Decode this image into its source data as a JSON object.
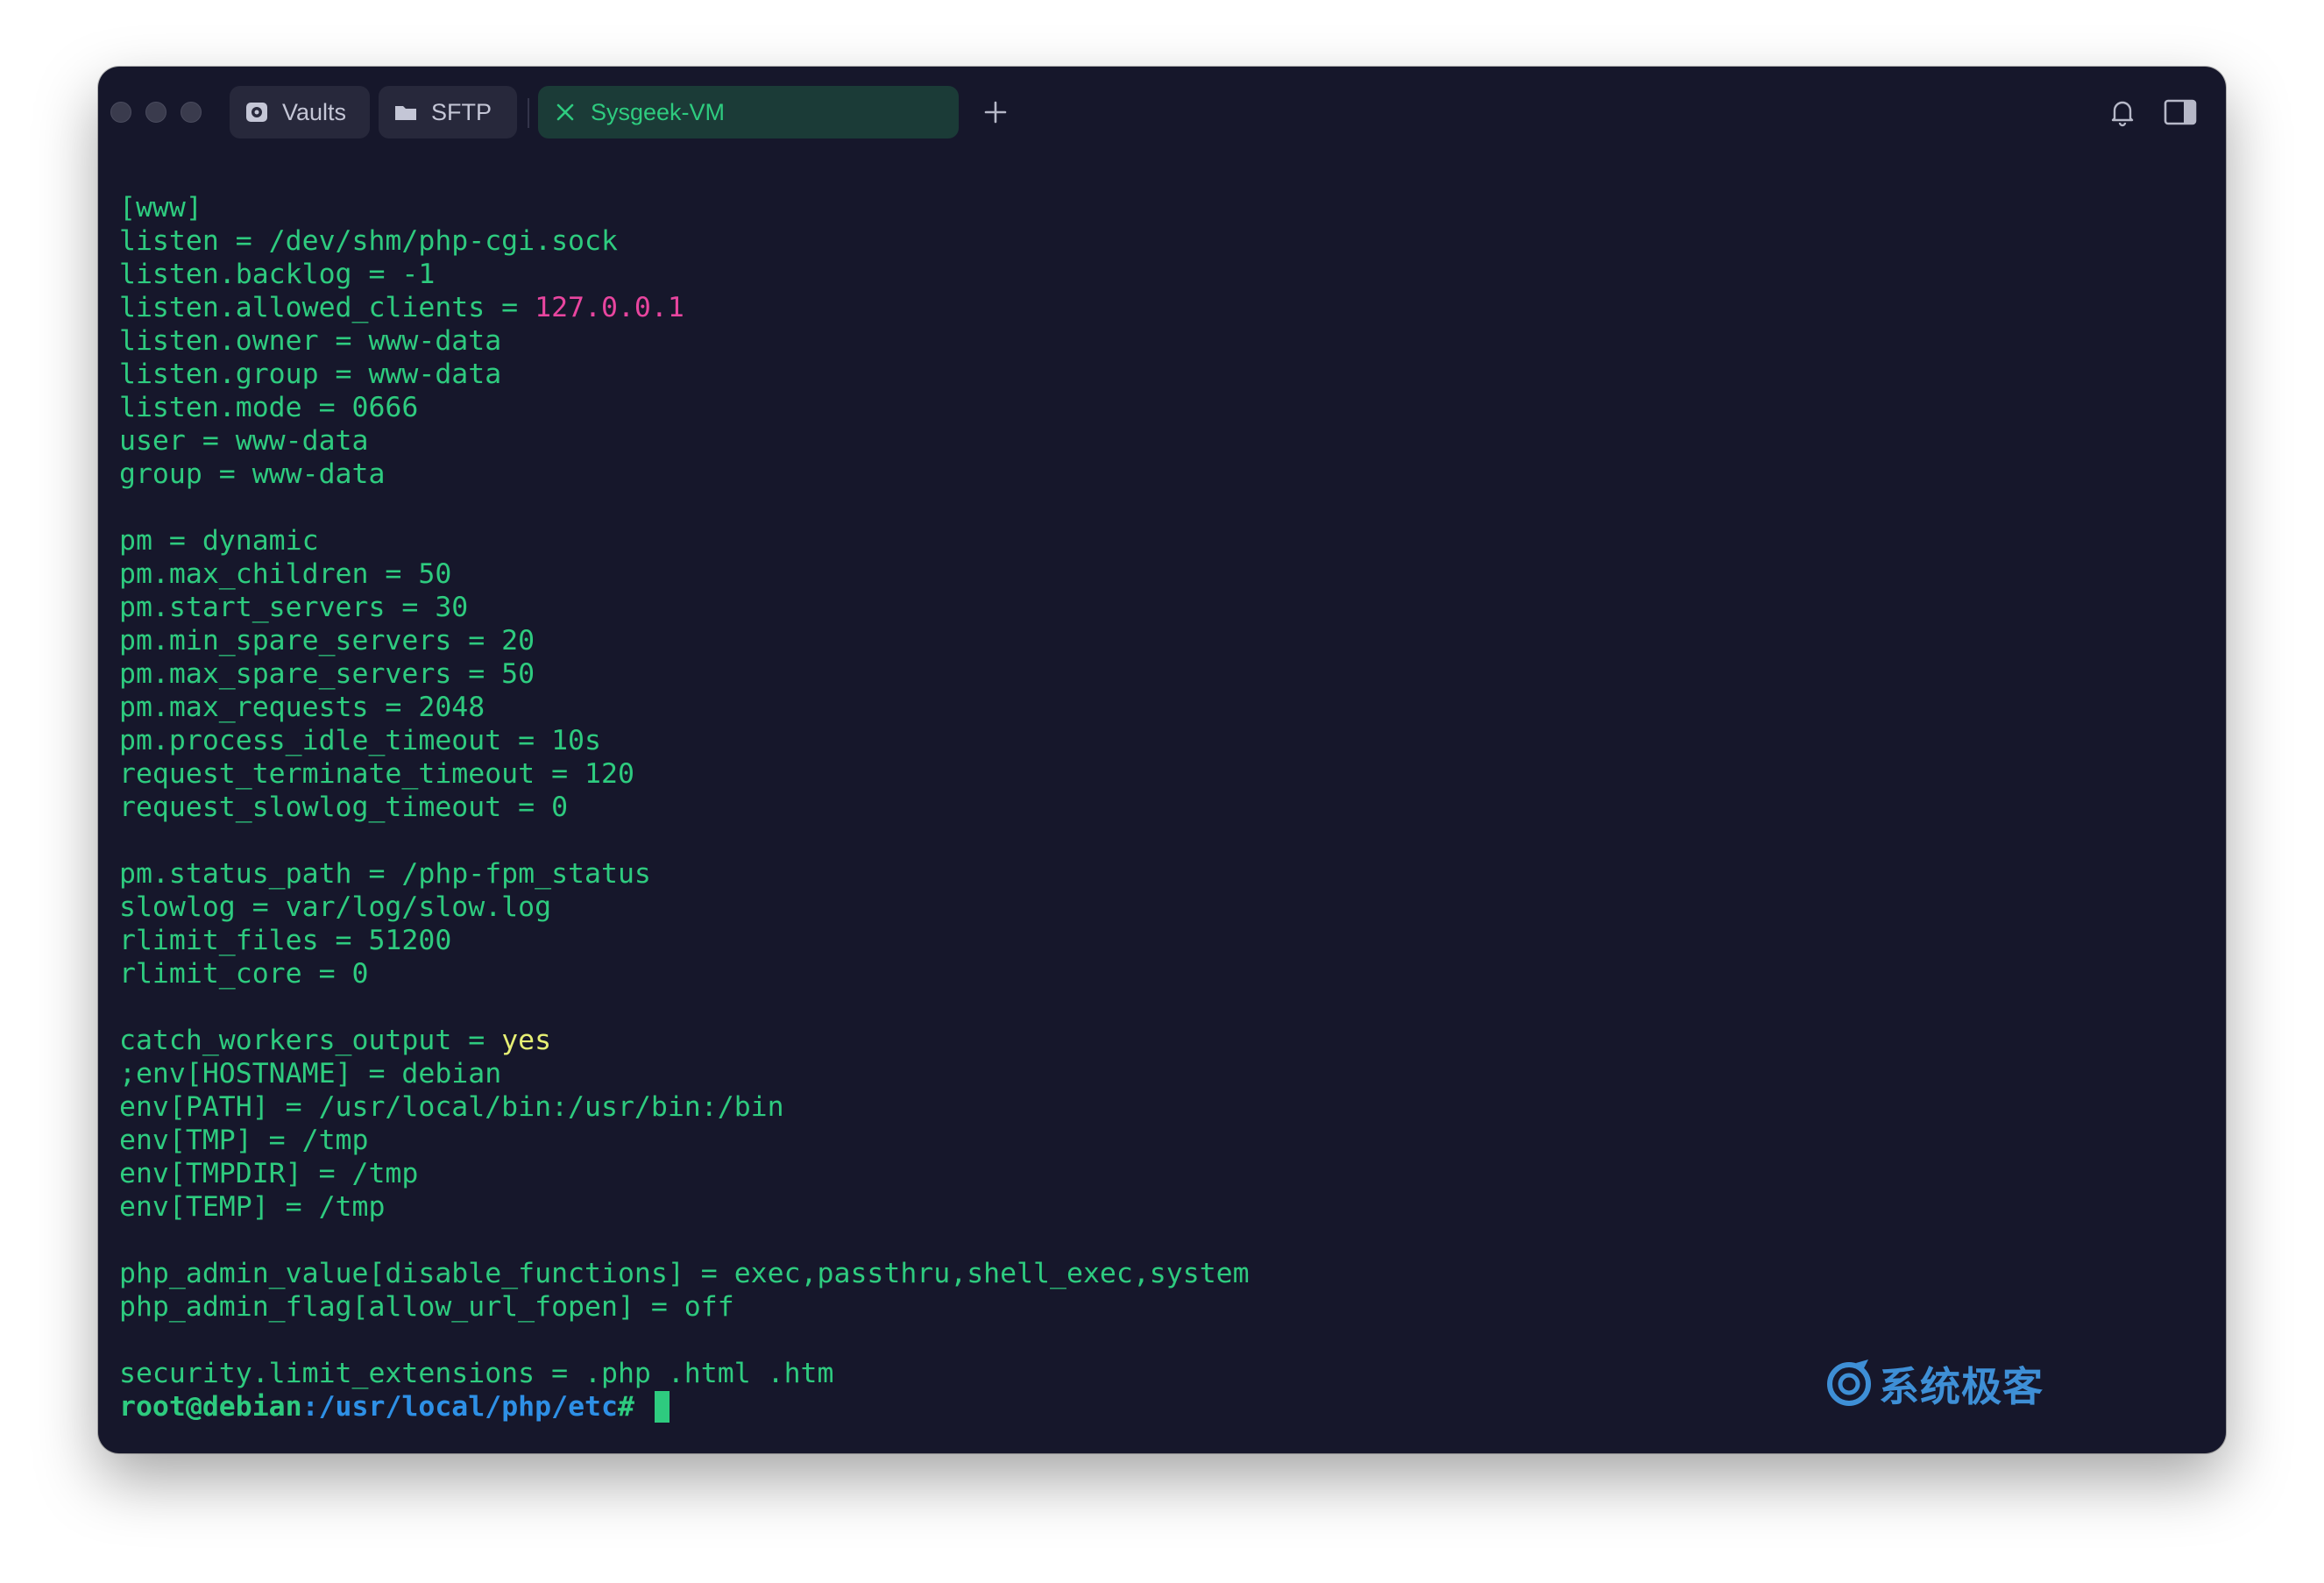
{
  "window": {
    "tabs": [
      {
        "label": "Vaults",
        "icon": "vault-icon"
      },
      {
        "label": "SFTP",
        "icon": "folder-icon"
      },
      {
        "label": "Sysgeek-VM",
        "icon": "close-icon",
        "active": true
      }
    ],
    "new_tab_icon": "plus-icon",
    "right_icons": [
      "bell-icon",
      "side-panel-icon"
    ]
  },
  "terminal": {
    "lines": [
      "[www]",
      "listen = /dev/shm/php-cgi.sock",
      "listen.backlog = -1",
      "listen.allowed_clients = ",
      "listen.owner = www-data",
      "listen.group = www-data",
      "listen.mode = 0666",
      "user = www-data",
      "group = www-data",
      "",
      "pm = dynamic",
      "pm.max_children = 50",
      "pm.start_servers = 30",
      "pm.min_spare_servers = 20",
      "pm.max_spare_servers = 50",
      "pm.max_requests = 2048",
      "pm.process_idle_timeout = 10s",
      "request_terminate_timeout = 120",
      "request_slowlog_timeout = 0",
      "",
      "pm.status_path = /php-fpm_status",
      "slowlog = var/log/slow.log",
      "rlimit_files = 51200",
      "rlimit_core = 0",
      "",
      "catch_workers_output = ",
      ";env[HOSTNAME] = debian",
      "env[PATH] = /usr/local/bin:/usr/bin:/bin",
      "env[TMP] = /tmp",
      "env[TMPDIR] = /tmp",
      "env[TEMP] = /tmp",
      "",
      "php_admin_value[disable_functions] = exec,passthru,shell_exec,system",
      "php_admin_flag[allow_url_fopen] = off",
      "",
      "security.limit_extensions = .php .html .htm"
    ],
    "allowed_clients_value": "127.0.0.1",
    "catch_workers_value": "yes",
    "prompt": {
      "user_host": "root@debian",
      "separator": ":",
      "path": "/usr/local/php/etc",
      "symbol": "# "
    }
  },
  "watermark": {
    "text": "系统极客",
    "logo": "sysgeek-logo"
  },
  "colors": {
    "background": "#16172b",
    "text": "#2ecb7f",
    "ip_highlight": "#e8459f",
    "keyword_highlight": "#e6ef74",
    "path": "#2e90e6",
    "tab_active": "#1b3b37"
  }
}
